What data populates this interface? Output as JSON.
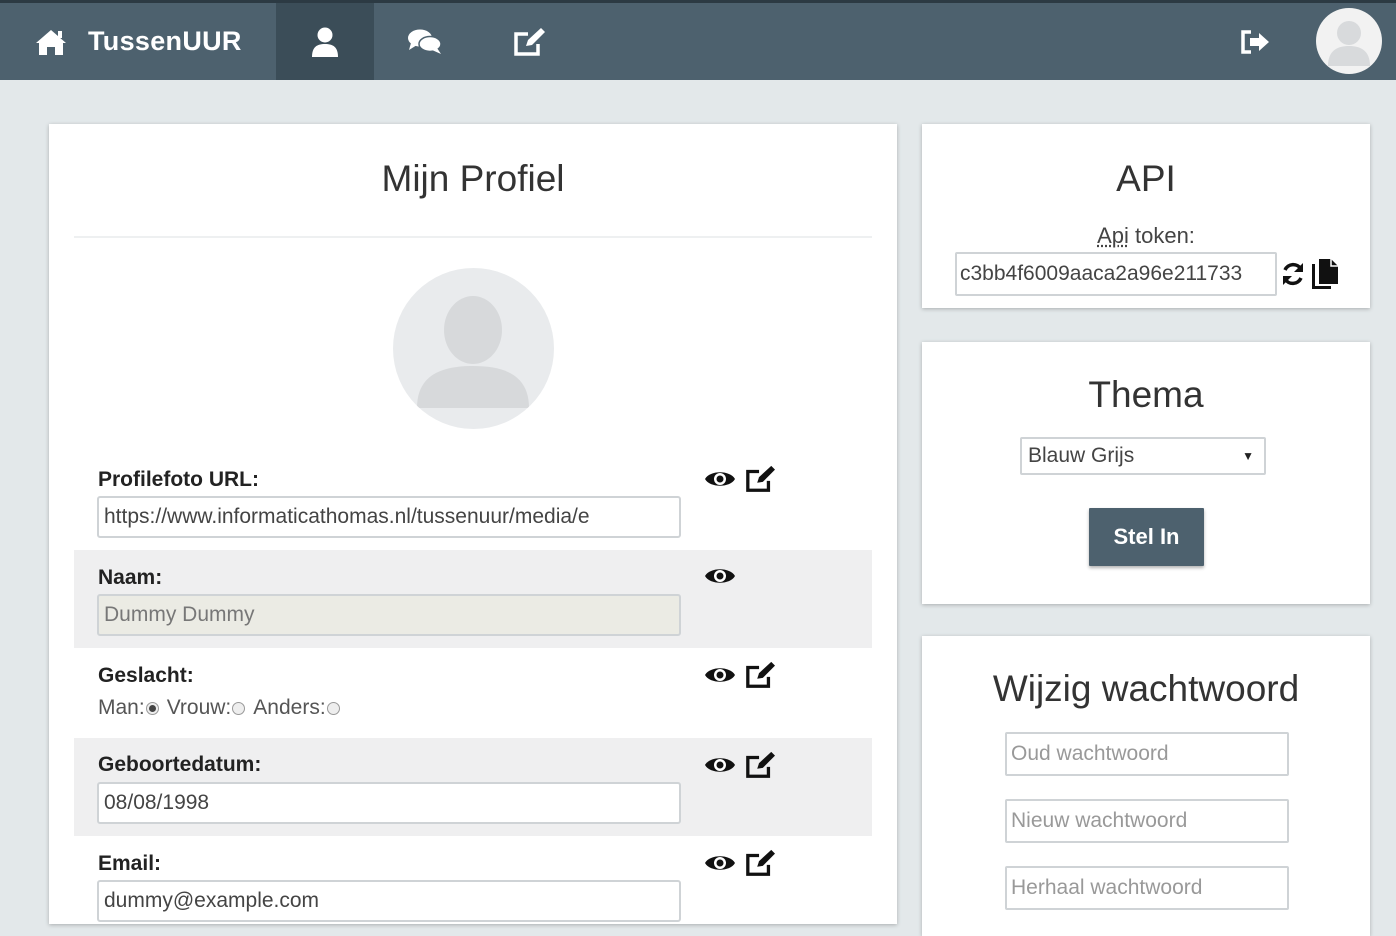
{
  "navbar": {
    "brand": "TussenUUR",
    "icons": {
      "home": "home-icon",
      "profile": "user-icon",
      "chat": "comments-icon",
      "edit": "edit-icon",
      "logout": "sign-out-icon"
    },
    "active_tab": "profile"
  },
  "profile": {
    "title": "Mijn Profiel",
    "fields": {
      "photo": {
        "label": "Profilefoto URL:",
        "value": "https://www.informaticathomas.nl/tussenuur/media/e"
      },
      "name": {
        "label": "Naam:",
        "value": "Dummy Dummy",
        "disabled": true
      },
      "gender": {
        "label": "Geslacht:",
        "options": [
          {
            "label": "Man:",
            "checked": true
          },
          {
            "label": "Vrouw:",
            "checked": false
          },
          {
            "label": "Anders:",
            "checked": false
          }
        ]
      },
      "birthdate": {
        "label": "Geboortedatum:",
        "value": "08/08/1998"
      },
      "email": {
        "label": "Email:",
        "value": "dummy@example.com"
      }
    }
  },
  "api": {
    "title": "API",
    "label_abbr": "Api",
    "label_rest": " token:",
    "token": "c3bb4f6009aaca2a96e211733"
  },
  "theme": {
    "title": "Thema",
    "selected": "Blauw Grijs",
    "button": "Stel In"
  },
  "password": {
    "title": "Wijzig wachtwoord",
    "old_placeholder": "Oud wachtwoord",
    "new_placeholder": "Nieuw wachtwoord",
    "repeat_placeholder": "Herhaal wachtwoord"
  },
  "colors": {
    "navbar": "#4d616e",
    "navbar_active": "#3b4d58",
    "page_bg": "#e3e8ea",
    "button": "#4d616e"
  }
}
